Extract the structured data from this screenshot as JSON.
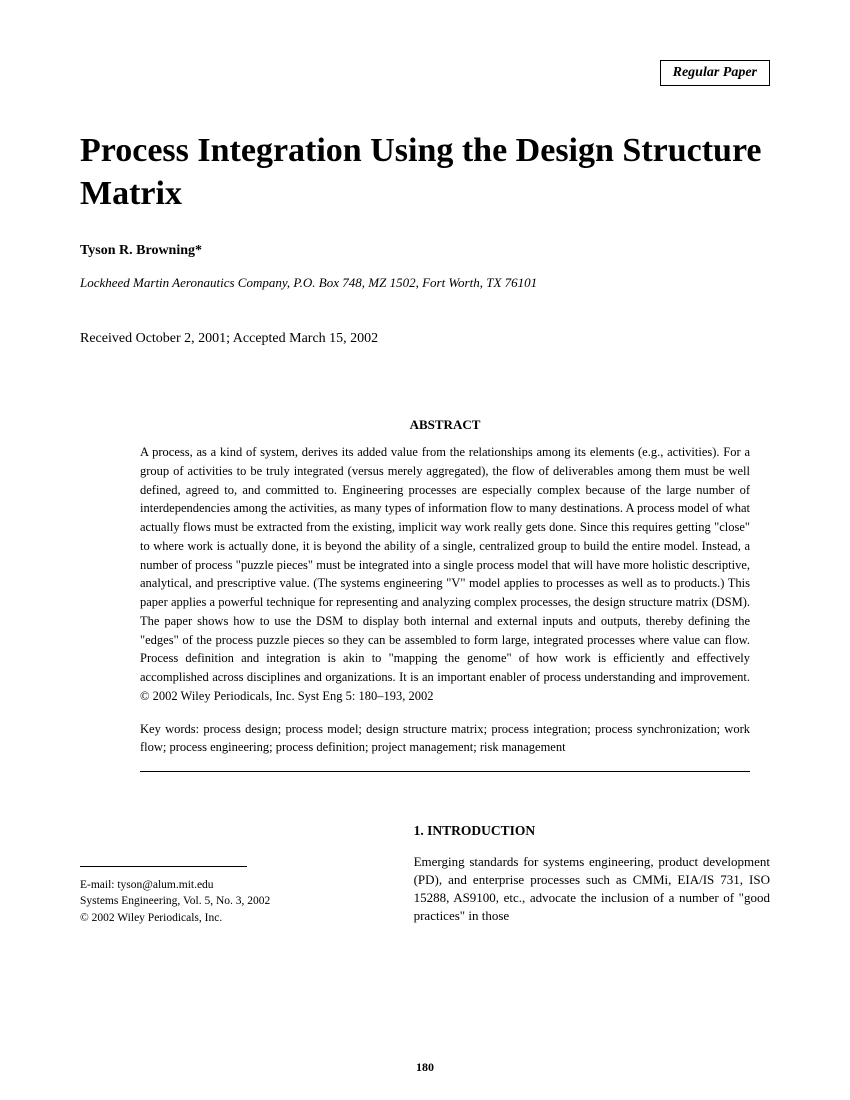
{
  "paper_type": "Regular Paper",
  "title": "Process Integration Using the Design Structure Matrix",
  "author": "Tyson R. Browning*",
  "affiliation": "Lockheed Martin Aeronautics Company, P.O. Box 748, MZ 1502, Fort Worth, TX 76101",
  "dates": "Received October 2, 2001; Accepted March 15, 2002",
  "abstract_heading": "ABSTRACT",
  "abstract_text": "A process, as a kind of system, derives its added value from the relationships among its elements (e.g., activities). For a group of activities to be truly integrated (versus merely aggregated), the flow of deliverables among them must be well defined, agreed to, and committed to. Engineering processes are especially complex because of the large number of interdependencies among the activities, as many types of information flow to many destinations. A process model of what actually flows must be extracted from the existing, implicit way work really gets done. Since this requires getting \"close\" to where work is actually done, it is beyond the ability of a single, centralized group to build the entire model. Instead, a number of process \"puzzle pieces\" must be integrated into a single process model that will have more holistic descriptive, analytical, and prescriptive value. (The systems engineering \"V\" model applies to processes as well as to products.) This paper applies a powerful technique for representing and analyzing complex processes, the design structure matrix (DSM). The paper shows how to use the DSM to display both internal and external inputs and outputs, thereby defining the \"edges\" of the process puzzle pieces so they can be assembled to form large, integrated processes where value can flow. Process definition and integration is akin to \"mapping the genome\" of how work is efficiently and effectively accomplished across disciplines and organizations. It is an important enabler of process understanding and improvement. © 2002 Wiley Periodicals, Inc. Syst Eng 5: 180–193, 2002",
  "keywords": "Key words: process design; process model; design structure matrix; process integration; process synchronization; work flow; process engineering; process definition; project management; risk management",
  "footer": {
    "email": "E-mail: tyson@alum.mit.edu",
    "journal": "Systems Engineering, Vol. 5, No. 3, 2002",
    "copyright": "© 2002 Wiley Periodicals, Inc."
  },
  "intro": {
    "heading": "1. INTRODUCTION",
    "text": "Emerging standards for systems engineering, product development (PD), and enterprise processes such as CMMi, EIA/IS 731, ISO 15288, AS9100, etc., advocate the inclusion of a number of \"good practices\" in those"
  },
  "page_number": "180"
}
